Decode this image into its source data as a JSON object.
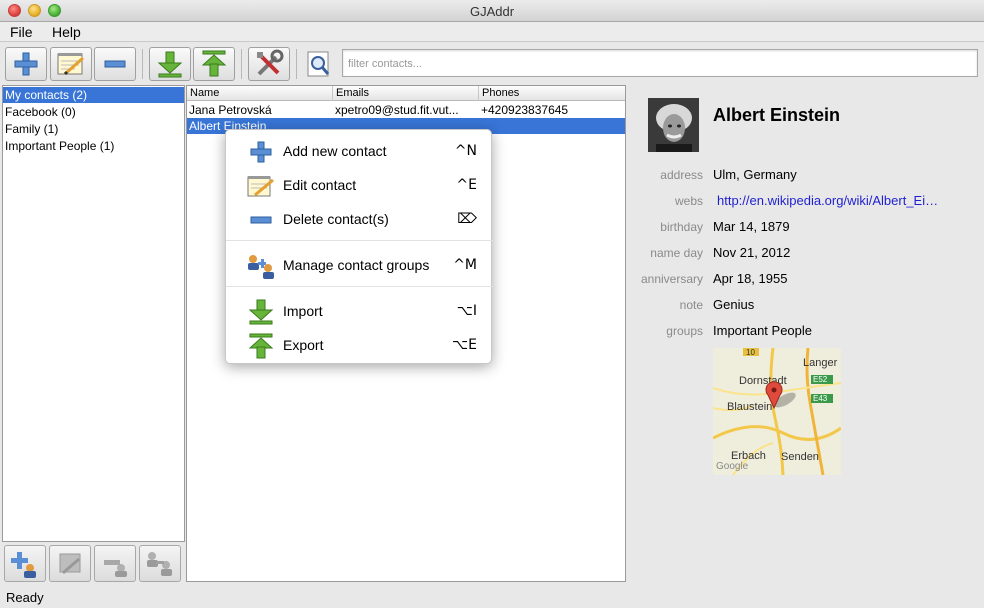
{
  "window": {
    "title": "GJAddr"
  },
  "menubar": {
    "file": "File",
    "help": "Help"
  },
  "toolbar": {
    "filter_placeholder": "filter contacts..."
  },
  "groups": {
    "items": [
      {
        "label": "My contacts (2)",
        "selected": true
      },
      {
        "label": "Facebook (0)",
        "selected": false
      },
      {
        "label": "Family (1)",
        "selected": false
      },
      {
        "label": "Important People (1)",
        "selected": false
      }
    ]
  },
  "table": {
    "headers": {
      "name": "Name",
      "emails": "Emails",
      "phones": "Phones"
    },
    "rows": [
      {
        "name": "Jana Petrovská",
        "email": "xpetro09@stud.fit.vut...",
        "phone": "+420923837645",
        "selected": false
      },
      {
        "name": "Albert Einstein",
        "email": "",
        "phone": "",
        "selected": true
      }
    ]
  },
  "context_menu": {
    "items": [
      {
        "label": "Add new contact",
        "shortcut": "^N",
        "icon": "plus-icon"
      },
      {
        "label": "Edit contact",
        "shortcut": "^E",
        "icon": "notepad-pencil-icon"
      },
      {
        "label": "Delete contact(s)",
        "shortcut": "⌦",
        "icon": "minus-icon"
      },
      {
        "label": "Manage contact groups",
        "shortcut": "^M",
        "icon": "people-groups-icon"
      },
      {
        "label": "Import",
        "shortcut": "⌥I",
        "icon": "import-arrow-icon"
      },
      {
        "label": "Export",
        "shortcut": "⌥E",
        "icon": "export-arrow-icon"
      }
    ]
  },
  "details": {
    "name": "Albert Einstein",
    "fields": [
      {
        "label": "address",
        "value": "Ulm, Germany",
        "link": false
      },
      {
        "label": "webs",
        "value": "http://en.wikipedia.org/wiki/Albert_Ei…",
        "link": true
      },
      {
        "label": "birthday",
        "value": "Mar 14, 1879",
        "link": false
      },
      {
        "label": "name day",
        "value": "Nov 21, 2012",
        "link": false
      },
      {
        "label": "anniversary",
        "value": "Apr 18, 1955",
        "link": false
      },
      {
        "label": "note",
        "value": "Genius",
        "link": false
      },
      {
        "label": "groups",
        "value": "Important People",
        "link": false
      }
    ],
    "map": {
      "labels": {
        "langer": "Langer",
        "dornstadt": "Dornstadt",
        "blaustein": "Blaustein",
        "erbach": "Erbach",
        "senden": "Senden",
        "google": "Google"
      },
      "road_badges": {
        "r10": "10",
        "e52": "E52",
        "e43": "E43"
      }
    }
  },
  "status": {
    "text": "Ready"
  },
  "colors": {
    "selection": "#3875d7",
    "link": "#1f1fd0",
    "label_gray": "#8a8a8a"
  }
}
